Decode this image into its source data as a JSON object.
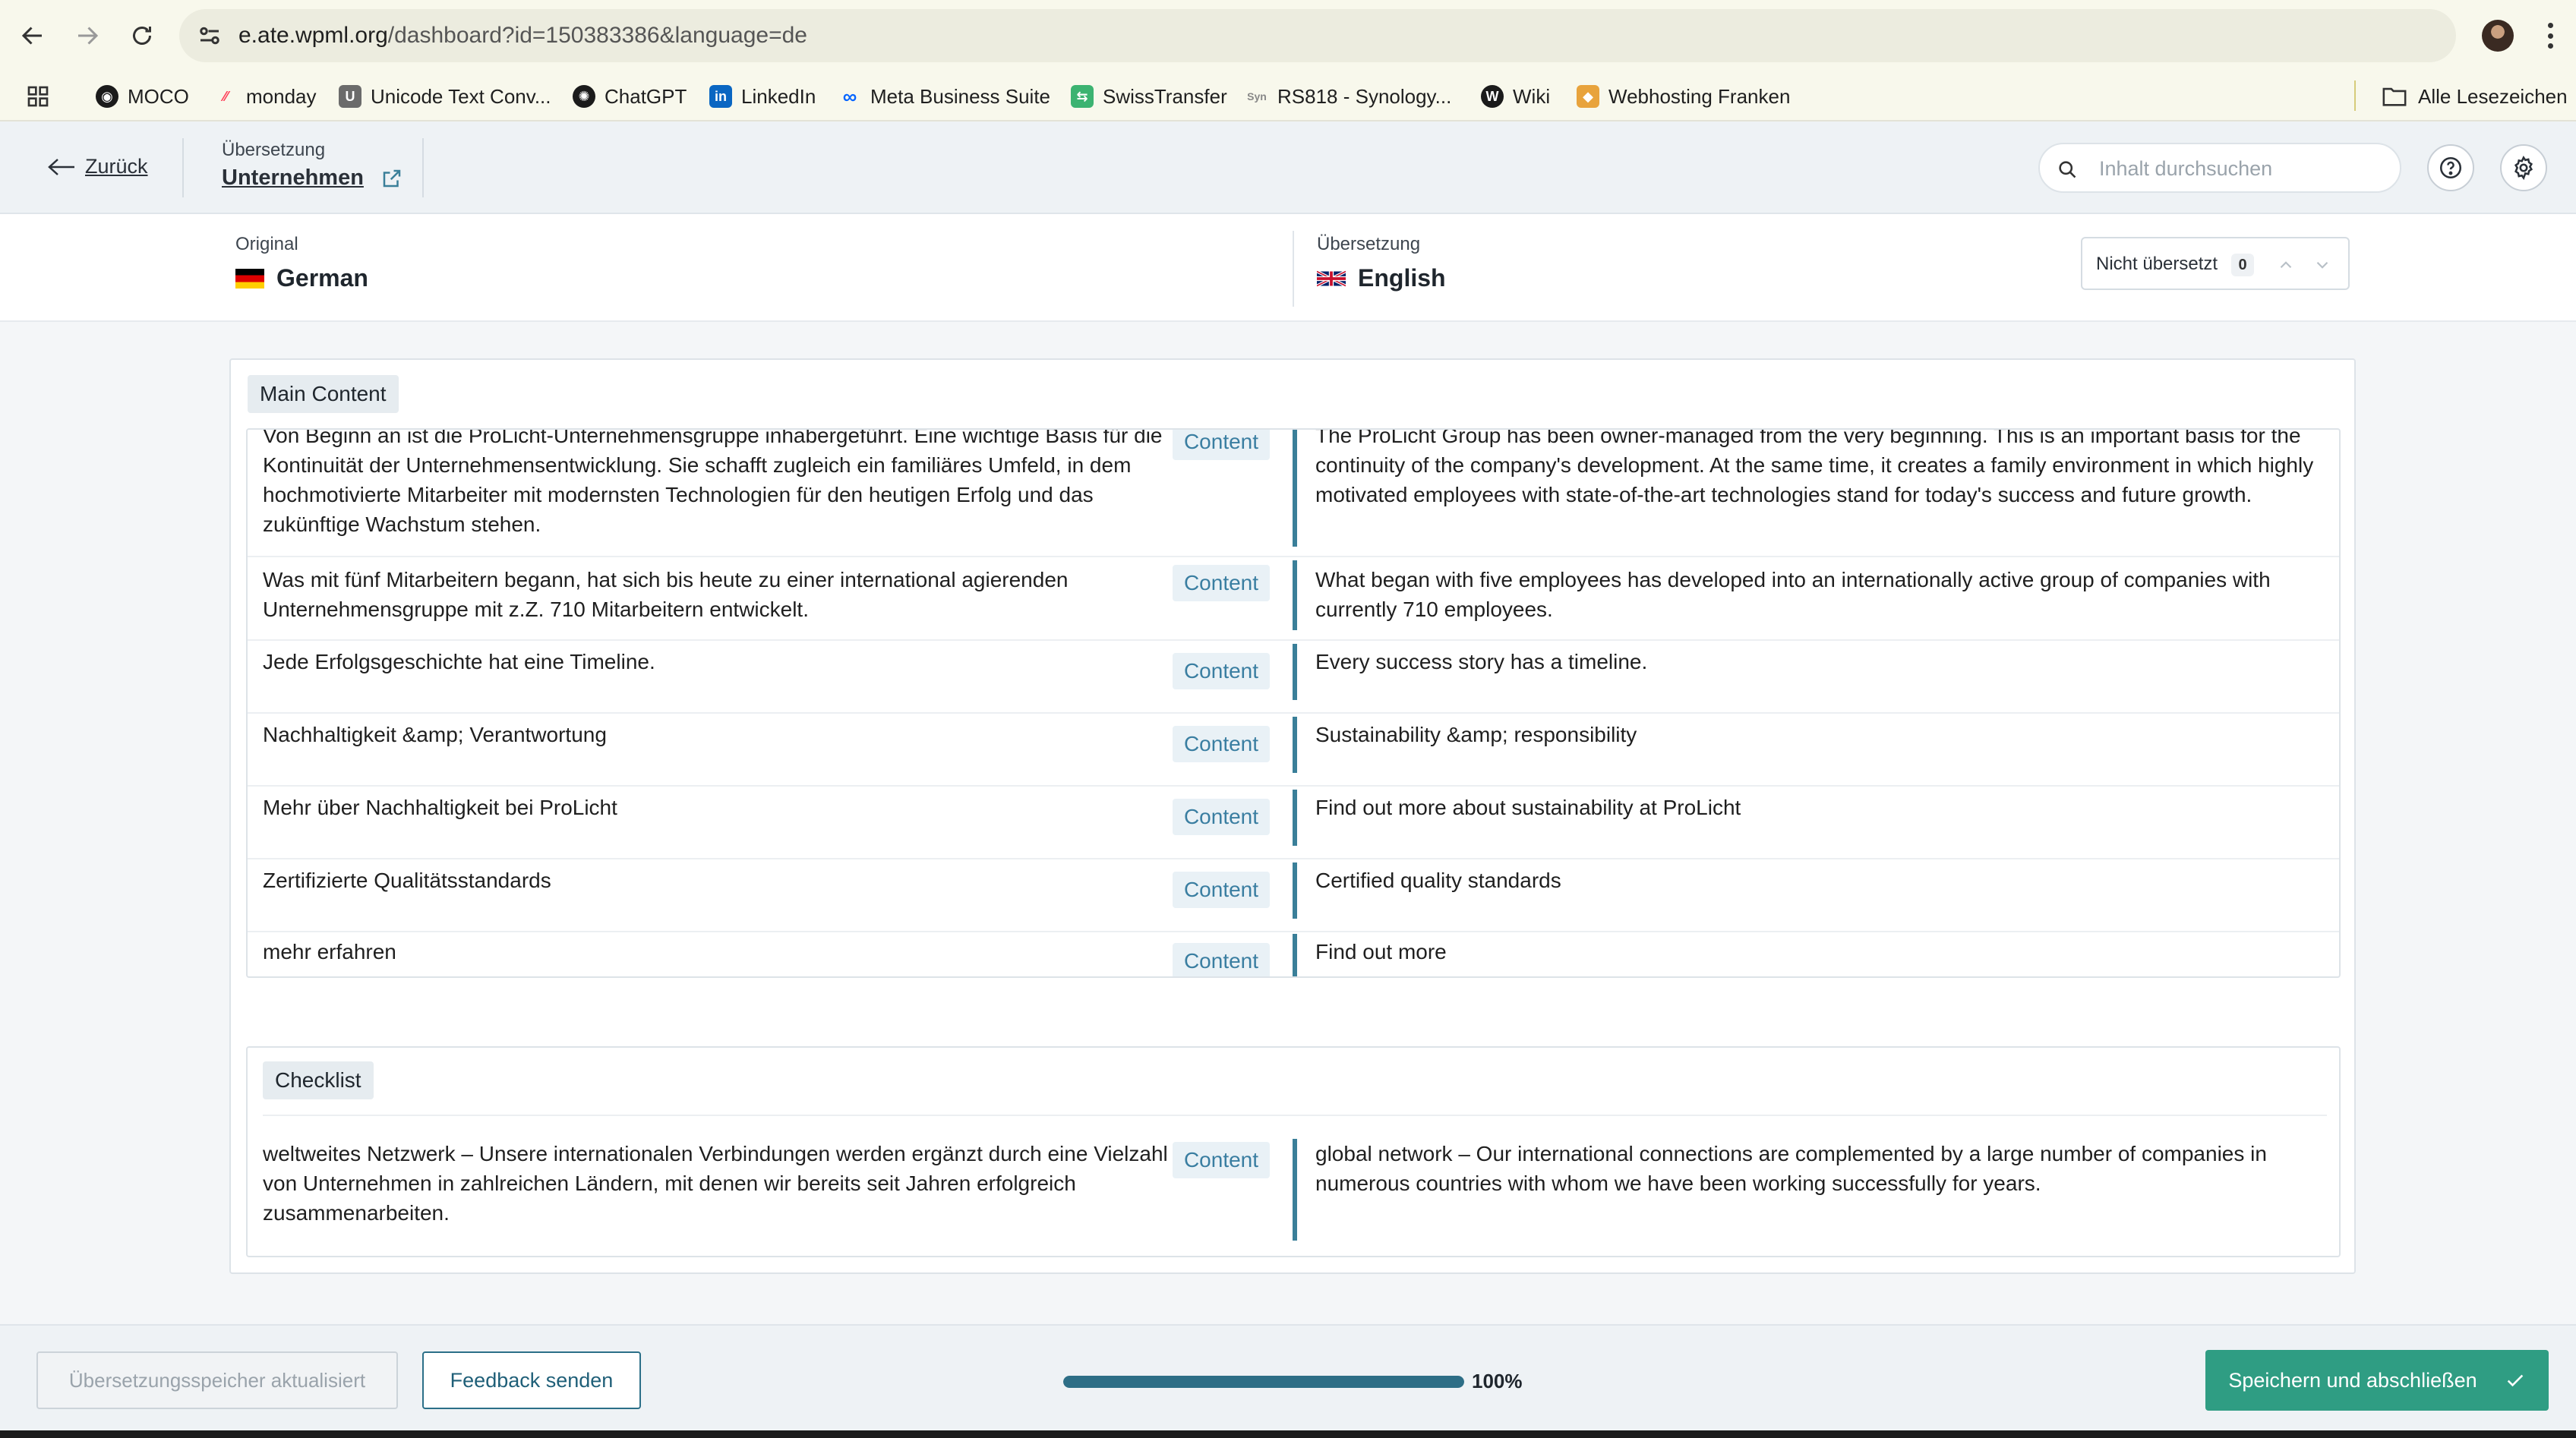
{
  "browser": {
    "url_domain": "e.ate.wpml.org",
    "url_path": "/dashboard?id=150383386&language=de",
    "bookmarks": [
      {
        "label": "MOCO",
        "icon": "moco-icon",
        "color": "#1b1b1b"
      },
      {
        "label": "monday",
        "icon": "monday-icon",
        "color": "#ff3d57"
      },
      {
        "label": "Unicode Text Conv...",
        "icon": "unicode-icon",
        "color": "#6b6b6b"
      },
      {
        "label": "ChatGPT",
        "icon": "chatgpt-icon",
        "color": "#1b1b1b"
      },
      {
        "label": "LinkedIn",
        "icon": "linkedin-icon",
        "color": "#0a66c2"
      },
      {
        "label": "Meta Business Suite",
        "icon": "meta-icon",
        "color": "#0866ff"
      },
      {
        "label": "SwissTransfer",
        "icon": "swisstransfer-icon",
        "color": "#3cb371"
      },
      {
        "label": "RS818 - Synology...",
        "icon": "synology-icon",
        "color": "#888888"
      },
      {
        "label": "Wiki",
        "icon": "wiki-icon",
        "color": "#1b1b1b"
      },
      {
        "label": "Webhosting Franken",
        "icon": "webhosting-icon",
        "color": "#e8a33c"
      }
    ],
    "all_bookmarks_label": "Alle Lesezeichen"
  },
  "header": {
    "back_label": "Zurück",
    "crumb_label": "Übersetzung",
    "crumb_title": "Unternehmen",
    "search_placeholder": "Inhalt durchsuchen"
  },
  "languages": {
    "original_label": "Original",
    "original_name": "German",
    "translation_label": "Übersetzung",
    "translation_name": "English",
    "filter_label": "Nicht übersetzt",
    "filter_count": "0"
  },
  "sections": [
    {
      "title": "Main Content",
      "rows": [
        {
          "source": "Von Beginn an ist die ProLicht-Unternehmensgruppe inhabergeführt. Eine wichtige Basis für die Kontinuität der Unternehmensentwicklung. Sie schafft zugleich ein familiäres Umfeld, in dem hochmotivierte Mitarbeiter mit modernsten Technologien für den heutigen Erfolg und das zukünftige Wachstum stehen.",
          "tag": "Content",
          "translation": "The ProLicht Group has been owner-managed from the very beginning. This is an important basis for the continuity of the company's development. At the same time, it creates a family environment in which highly motivated employees with state-of-the-art technologies stand for today's success and future growth."
        },
        {
          "source": "Was mit fünf Mitarbeitern begann, hat sich bis heute zu einer international agierenden Unternehmensgruppe mit z.Z. 710 Mitarbeitern entwickelt.",
          "tag": "Content",
          "translation": "What began with five employees has developed into an internationally active group of companies with currently 710 employees."
        },
        {
          "source": "Jede Erfolgsgeschichte hat eine Timeline.",
          "tag": "Content",
          "translation": "Every success story has a timeline."
        },
        {
          "source": "Nachhaltigkeit &amp; Verantwortung",
          "tag": "Content",
          "translation": "Sustainability &amp; responsibility"
        },
        {
          "source": "Mehr über Nachhaltigkeit bei ProLicht",
          "tag": "Content",
          "translation": "Find out more about sustainability at ProLicht"
        },
        {
          "source": "Zertifizierte Qualitätsstandards",
          "tag": "Content",
          "translation": "Certified quality standards"
        },
        {
          "source": "mehr erfahren",
          "tag": "Content",
          "translation": "Find out more"
        }
      ]
    },
    {
      "title": "Checklist",
      "rows": [
        {
          "source": "weltweites Netzwerk – Unsere internationalen Verbindungen werden ergänzt durch eine Vielzahl von Unternehmen in zahlreichen Ländern, mit denen wir bereits seit Jahren erfolgreich zusammenarbeiten.",
          "tag": "Content",
          "translation": "global network – Our international connections are complemented by a large number of companies in numerous countries with whom we have been working successfully for years."
        }
      ]
    }
  ],
  "footer": {
    "memory_button": "Übersetzungsspeicher aktualisiert",
    "feedback_button": "Feedback senden",
    "progress_value": 100,
    "progress_label": "100%",
    "save_button": "Speichern und abschließen"
  },
  "colors": {
    "accent": "#2d6e86",
    "primary_button": "#2f9d83",
    "content_tag_text": "#3a7ea1"
  }
}
